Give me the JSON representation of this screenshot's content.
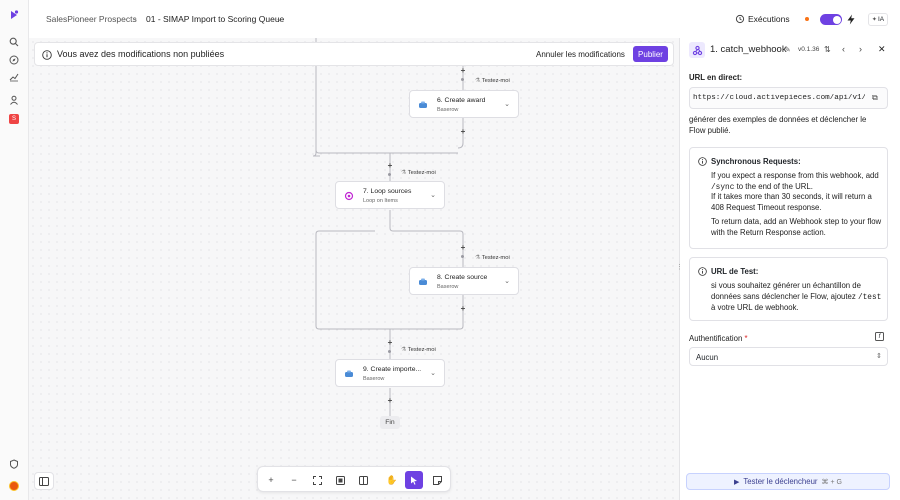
{
  "topbar": {
    "breadcrumb_root": "SalesPioneer Prospects",
    "separator": "›",
    "flow_name": "01 - SIMAP Import to Scoring Queue",
    "executions_label": "Exécutions",
    "ai_label": "IA"
  },
  "banner": {
    "message": "Vous avez des modifications non publiées",
    "discard_label": "Annuler les modifications",
    "publish_label": "Publier"
  },
  "canvas": {
    "test_tag": "Testez-moi",
    "steps": [
      {
        "title": "6. Create award",
        "subtitle": "Baserow"
      },
      {
        "title": "7. Loop sources",
        "subtitle": "Loop on Items"
      },
      {
        "title": "8. Create source",
        "subtitle": "Baserow"
      },
      {
        "title": "9. Create importe...",
        "subtitle": "Baserow"
      }
    ],
    "end_label": "Fin"
  },
  "panel": {
    "step_title": "1. catch_webhook",
    "version": "v0.1.36",
    "url_label": "URL en direct:",
    "url_value": "https://cloud.activepieces.com/api/v1/w",
    "generate_text": "générer des exemples de données et déclencher le Flow publié.",
    "sync": {
      "title": "Synchronous Requests:",
      "line1a": "If you expect a response from this webhook, add",
      "line1_code": "/sync",
      "line1b": "to the end of the URL.",
      "line2": "If it takes more than 30 seconds, it will return a 408 Request Timeout response.",
      "line3": "To return data, add an Webhook step to your flow with the Return Response action."
    },
    "test_url": {
      "title": "URL de Test:",
      "text_a": "si vous souhaitez générer un échantillon de données sans déclencher le Flow, ajoutez",
      "code": "/test",
      "text_b": "à votre URL de webhook."
    },
    "auth_label": "Authentification",
    "auth_required": "*",
    "auth_value": "Aucun",
    "test_trigger_label": "Tester le déclencheur",
    "shortcut": "⌘ + G"
  },
  "colors": {
    "accent": "#6e41e2",
    "unpublished_dot": "#f97316"
  }
}
